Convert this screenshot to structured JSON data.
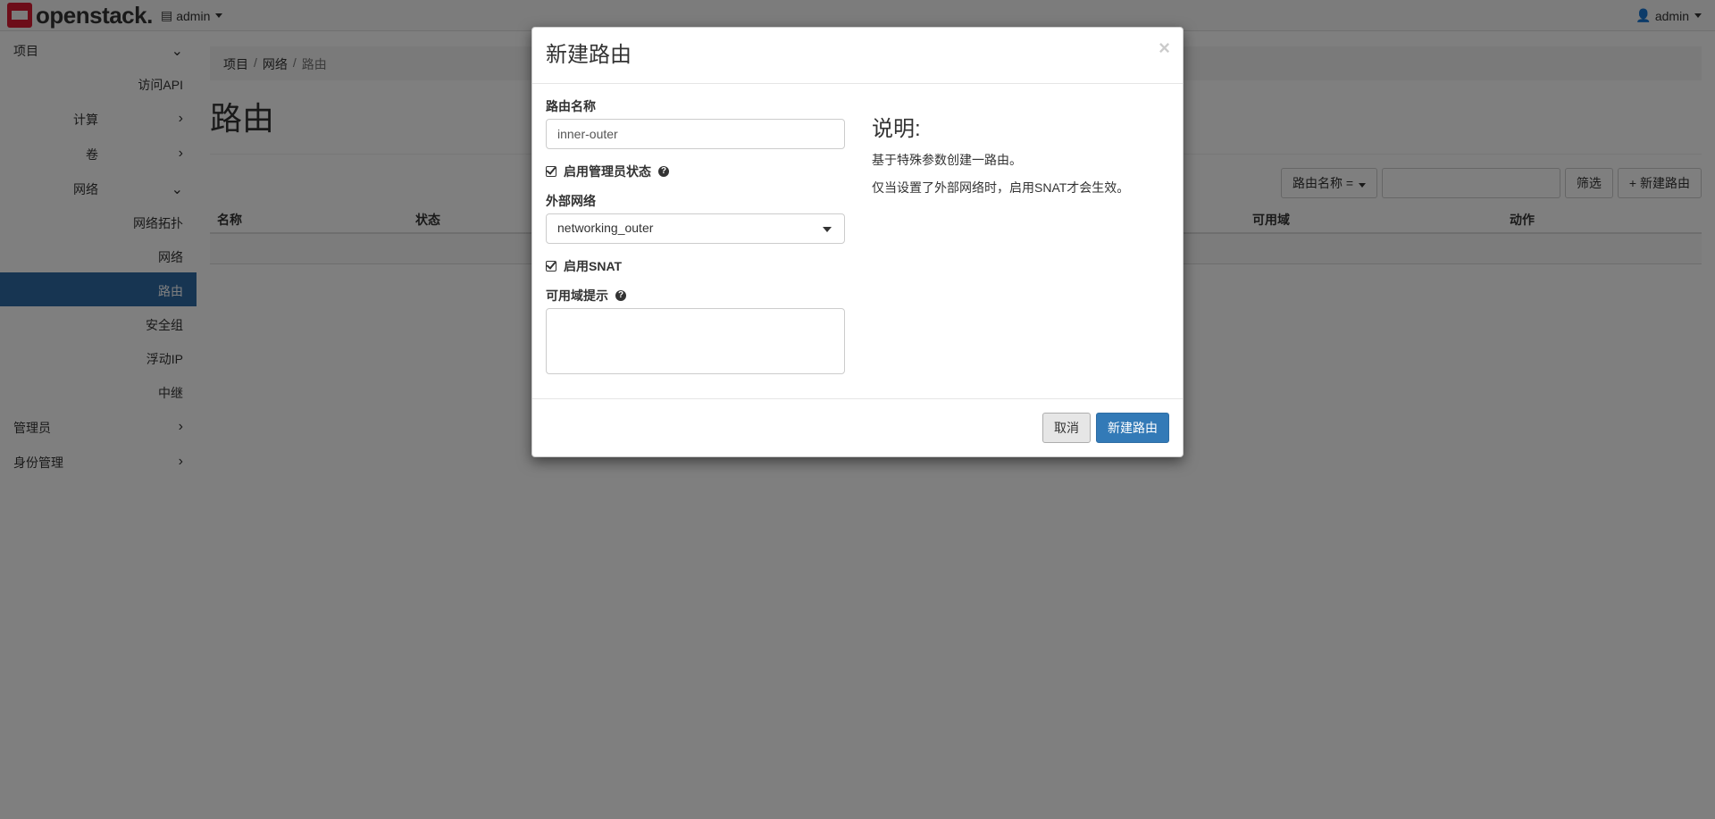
{
  "topbar": {
    "brand": "openstack.",
    "project_label": "admin",
    "user_label": "admin"
  },
  "sidebar": {
    "items": [
      {
        "label": "项目",
        "level": 1,
        "expanded": true
      },
      {
        "label": "访问API",
        "level": 3
      },
      {
        "label": "计算",
        "level": 2
      },
      {
        "label": "卷",
        "level": 2
      },
      {
        "label": "网络",
        "level": 2,
        "expanded": true
      },
      {
        "label": "网络拓扑",
        "level": 3
      },
      {
        "label": "网络",
        "level": 3
      },
      {
        "label": "路由",
        "level": 3,
        "active": true
      },
      {
        "label": "安全组",
        "level": 3
      },
      {
        "label": "浮动IP",
        "level": 3
      },
      {
        "label": "中继",
        "level": 3
      },
      {
        "label": "管理员",
        "level": 1
      },
      {
        "label": "身份管理",
        "level": 1
      }
    ]
  },
  "breadcrumb": [
    "项目",
    "网络",
    "路由"
  ],
  "page": {
    "title": "路由",
    "filter_dropdown": "路由名称 =",
    "filter_button": "筛选",
    "create_button": "新建路由"
  },
  "table": {
    "columns": [
      "名称",
      "状态",
      "可用域",
      "动作"
    ]
  },
  "modal": {
    "title": "新建路由",
    "close": "×",
    "fields": {
      "router_name": {
        "label": "路由名称",
        "value": "inner-outer"
      },
      "admin_state": {
        "label": "启用管理员状态",
        "checked": true
      },
      "external_network": {
        "label": "外部网络",
        "value": "networking_outer"
      },
      "enable_snat": {
        "label": "启用SNAT",
        "checked": true
      },
      "az_hints": {
        "label": "可用域提示",
        "value": ""
      }
    },
    "description": {
      "title": "说明:",
      "line1": "基于特殊参数创建一路由。",
      "line2": "仅当设置了外部网络时，启用SNAT才会生效。"
    },
    "buttons": {
      "cancel": "取消",
      "submit": "新建路由"
    }
  },
  "colors": {
    "active_nav": "#2f6aa5",
    "primary_button": "#337ab7",
    "brand_red": "#da1a32"
  }
}
